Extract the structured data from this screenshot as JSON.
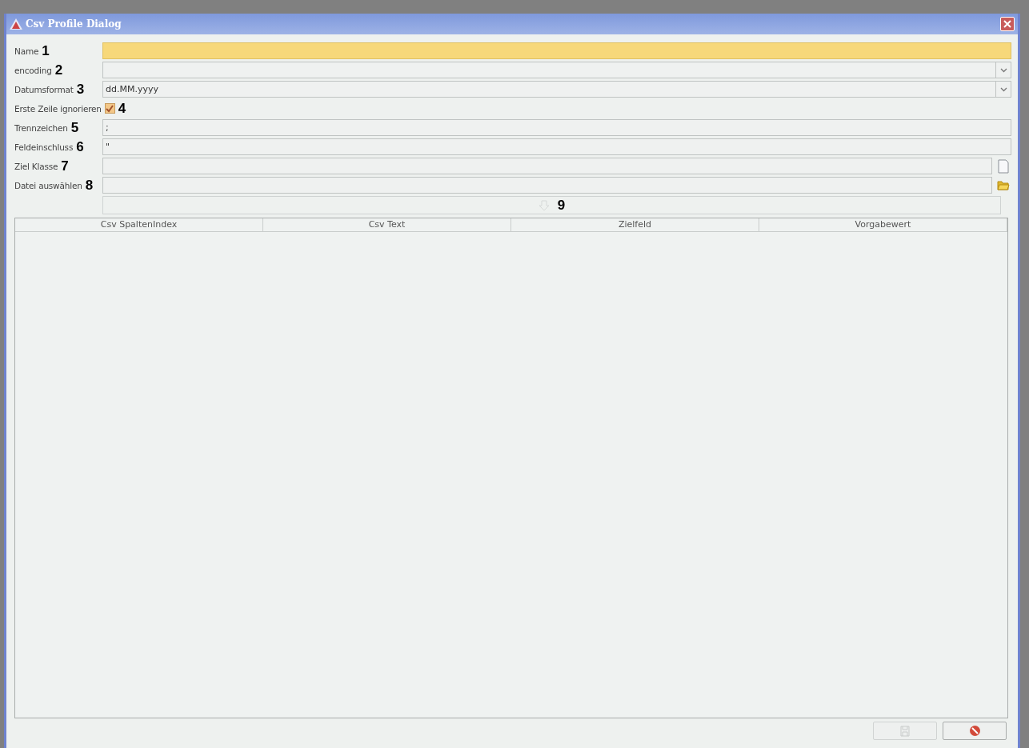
{
  "window": {
    "title": "Csv Profile Dialog"
  },
  "fields": [
    {
      "label": "Name",
      "marker": "1",
      "kind": "text",
      "highlighted": true
    },
    {
      "label": "encoding",
      "marker": "2",
      "kind": "combo",
      "highlighted": false
    },
    {
      "label": "Datumsformat",
      "marker": "3",
      "kind": "combo",
      "value": "dd.MM.yyyy",
      "highlighted": false
    },
    {
      "label": "Erste Zeile ignorieren",
      "marker": "4",
      "kind": "checkbox",
      "checked": true
    },
    {
      "label": "Trennzeichen",
      "marker": "5",
      "kind": "text",
      "value": ";",
      "highlighted": false
    },
    {
      "label": "Feldeinschluss",
      "marker": "6",
      "kind": "text",
      "value": "\"",
      "highlighted": false
    },
    {
      "label": "Ziel Klasse",
      "marker": "7",
      "kind": "file",
      "highlighted": false
    },
    {
      "label": "Datei auswählen",
      "marker": "8",
      "kind": "folder",
      "highlighted": false
    }
  ],
  "import_button": {
    "marker": "9",
    "disabled": true
  },
  "table": {
    "columns": [
      "Csv SpaltenIndex",
      "Csv Text",
      "Zielfeld",
      "Vorgabewert"
    ]
  },
  "buttons": [
    {
      "kind": "save",
      "disabled": true
    },
    {
      "kind": "cancel",
      "disabled": false
    }
  ]
}
